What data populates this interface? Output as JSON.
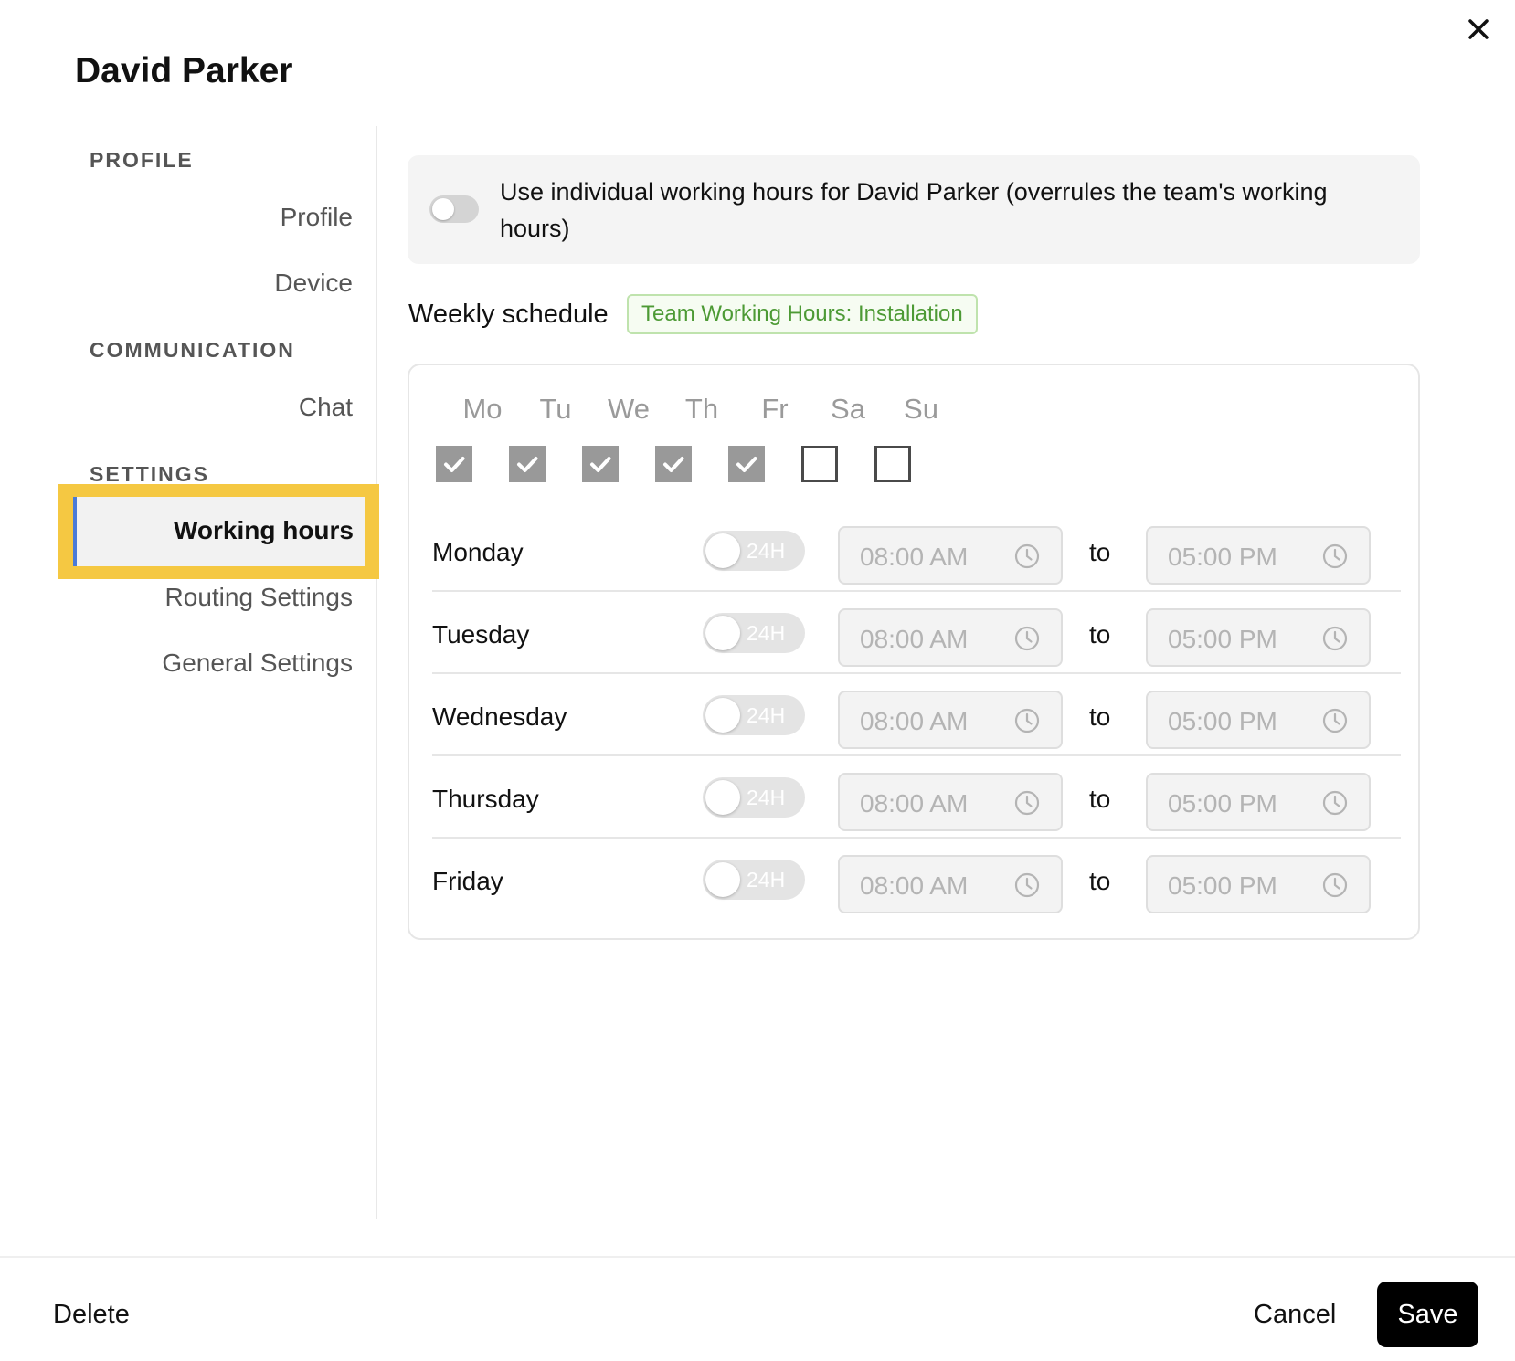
{
  "dialog": {
    "title": "David Parker",
    "close_icon": "close-icon"
  },
  "sidebar": {
    "sections": [
      {
        "heading": "PROFILE",
        "items": [
          "Profile",
          "Device"
        ]
      },
      {
        "heading": "COMMUNICATION",
        "items": [
          "Chat"
        ]
      },
      {
        "heading": "SETTINGS",
        "items": [
          "Working hours",
          "Routing Settings",
          "General Settings"
        ]
      }
    ],
    "active_item": "Working hours",
    "active_accent": "#4a7bd8",
    "highlight_color": "#f5c842"
  },
  "main": {
    "override_toggle": {
      "on": false,
      "label": "Use individual working hours for David Parker (overrules the team's working hours)"
    },
    "weekly_schedule_label": "Weekly schedule",
    "team_badge": "Team Working Hours: Installation",
    "day_headers": [
      "Mo",
      "Tu",
      "We",
      "Th",
      "Fr",
      "Sa",
      "Su"
    ],
    "day_checked": [
      true,
      true,
      true,
      true,
      true,
      false,
      false
    ],
    "rows": [
      {
        "day": "Monday",
        "toggle_label": "24H",
        "from": "08:00 AM",
        "to_word": "to",
        "to": "05:00 PM"
      },
      {
        "day": "Tuesday",
        "toggle_label": "24H",
        "from": "08:00 AM",
        "to_word": "to",
        "to": "05:00 PM"
      },
      {
        "day": "Wednesday",
        "toggle_label": "24H",
        "from": "08:00 AM",
        "to_word": "to",
        "to": "05:00 PM"
      },
      {
        "day": "Thursday",
        "toggle_label": "24H",
        "from": "08:00 AM",
        "to_word": "to",
        "to": "05:00 PM"
      },
      {
        "day": "Friday",
        "toggle_label": "24H",
        "from": "08:00 AM",
        "to_word": "to",
        "to": "05:00 PM"
      }
    ]
  },
  "footer": {
    "delete_label": "Delete",
    "cancel_label": "Cancel",
    "save_label": "Save"
  },
  "colors": {
    "badge_text": "#4d9a35",
    "badge_border": "#bfe3ad",
    "save_bg": "#000000"
  }
}
